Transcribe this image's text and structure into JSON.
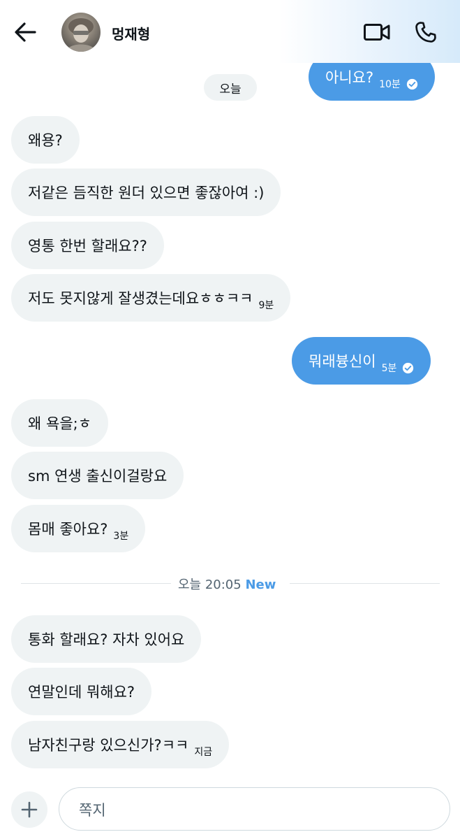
{
  "header": {
    "contact_name": "멍재형",
    "back_icon": "arrow-left-icon",
    "video_icon": "video-camera-icon",
    "call_icon": "phone-icon",
    "accent_color": "#4b9be6"
  },
  "messages": [
    {
      "direction": "out",
      "text": "아니요?",
      "time": "10분",
      "read": true
    },
    {
      "direction": "in",
      "text": "왜용?",
      "time": ""
    },
    {
      "direction": "in",
      "text": "저같은 듬직한 원더 있으면 좋잖아여 :)",
      "time": ""
    },
    {
      "direction": "in",
      "text": "영통 한번 할래요??",
      "time": ""
    },
    {
      "direction": "in",
      "text": "저도 못지않게 잘생겼는데요ㅎㅎㅋㅋ",
      "time": "9분"
    },
    {
      "direction": "out",
      "text": "뭐래븅신이",
      "time": "5분",
      "read": true
    },
    {
      "direction": "in",
      "text": "왜 욕을;ㅎ",
      "time": ""
    },
    {
      "direction": "in",
      "text": "sm 연생 출신이걸랑요",
      "time": ""
    },
    {
      "direction": "in",
      "text": "몸매 좋아요?",
      "time": "3분"
    },
    {
      "direction": "in",
      "text": "통화 할래요? 자차 있어요",
      "time": ""
    },
    {
      "direction": "in",
      "text": "연말인데 뭐해요?",
      "time": ""
    },
    {
      "direction": "in",
      "text": "남자친구랑 있으신가?ㅋㅋ",
      "time": "지금"
    }
  ],
  "date_pill": "오늘",
  "divider": {
    "text": "오늘 20:05",
    "new_label": "New"
  },
  "composer": {
    "placeholder": "쪽지",
    "add_icon": "plus-icon"
  },
  "colors": {
    "incoming_bubble": "#eff3f4",
    "outgoing_bubble": "#4b9be6"
  }
}
